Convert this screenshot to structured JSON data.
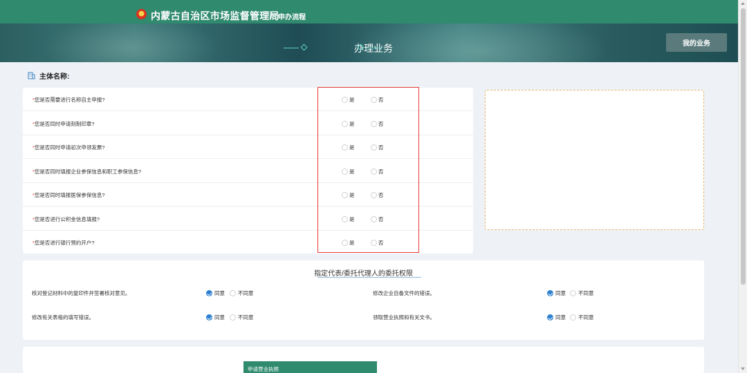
{
  "header": {
    "site_title": "内蒙古自治区市场监督管理局",
    "nav_link": "申办流程",
    "emblem_icon": "national-emblem-icon"
  },
  "banner": {
    "title": "办理业务",
    "my_business_button": "我的业务"
  },
  "subject": {
    "label": "主体名称:",
    "icon": "building-icon"
  },
  "questions": [
    {
      "text": "您是否需要进行名称自主申报?",
      "yes": "是",
      "no": "否"
    },
    {
      "text": "您是否同时申请刻制印章?",
      "yes": "是",
      "no": "否"
    },
    {
      "text": "您是否同时申请初次申领发票?",
      "yes": "是",
      "no": "否"
    },
    {
      "text": "您是否同时填报企业参保信息和职工参保信息?",
      "yes": "是",
      "no": "否"
    },
    {
      "text": "您是否同时填报医保参保信息?",
      "yes": "是",
      "no": "否"
    },
    {
      "text": "您是否进行公积金信息填报?",
      "yes": "是",
      "no": "否"
    },
    {
      "text": "您是否进行银行预约开户?",
      "yes": "是",
      "no": "否"
    }
  ],
  "authorization": {
    "title": "指定代表/委托代理人的委托权限",
    "agree": "同意",
    "disagree": "不同意",
    "items": [
      {
        "text": "核对登记材料中的复印件并签署核对意见。",
        "selected": "同意"
      },
      {
        "text": "修改企业自备文件的错误。",
        "selected": "同意"
      },
      {
        "text": "修改有关表格的填写错误。",
        "selected": "同意"
      },
      {
        "text": "领取营业执照和有关文书。",
        "selected": "同意"
      }
    ]
  },
  "bottom": {
    "apply_tab": "申请营业执照"
  },
  "colors": {
    "header_green": "#2f8a6e",
    "required_red": "#e33",
    "highlight_red": "#e53935",
    "checked_blue": "#2b7fd0"
  }
}
